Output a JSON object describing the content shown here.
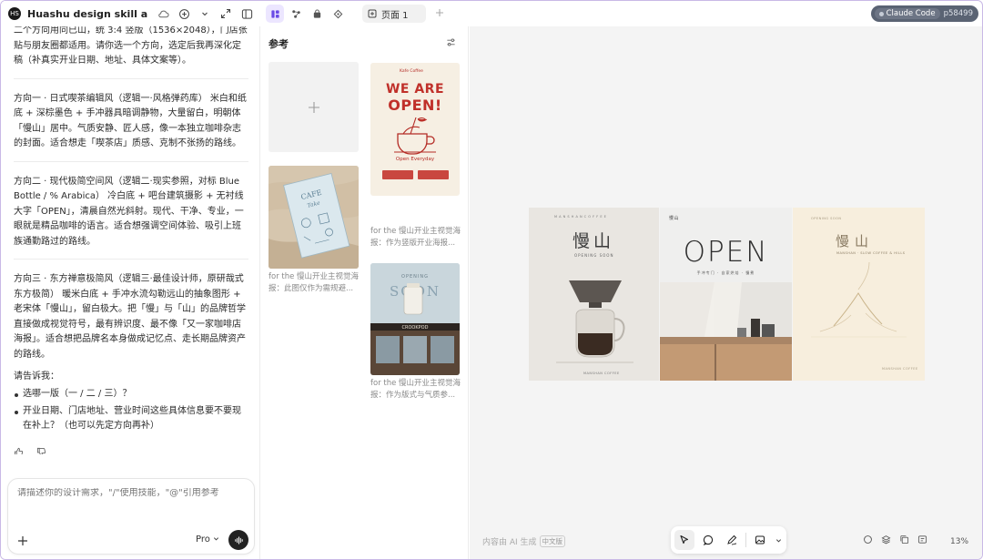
{
  "chat": {
    "logo_text": "HS",
    "title": "Huashu design skill activati...",
    "paragraphs": [
      "二个方向用同已山，统 3:4 竖版（1536×2048），门店张贴与朋友圈都适用。请你选一个方向，选定后我再深化定稿（补真实开业日期、地址、具体文案等）。",
      "方向一 · 日式喫茶编辑风（逻辑一·风格弹药库） 米白和纸底 + 深棕墨色 + 手冲器具暗调静物，大量留白，明朝体「慢山」居中。气质安静、匠人感，像一本独立咖啡杂志的封面。适合想走「喫茶店」质感、克制不张扬的路线。",
      "方向二 · 现代极简空间风（逻辑二·现实参照，对标 Blue Bottle / % Arabica） 冷白底 + 吧台建筑摄影 + 无衬线大字「OPEN」，清晨自然光斜射。现代、干净、专业，一眼就是精品咖啡的语言。适合想强调空间体验、吸引上班族通勤路过的路线。",
      "方向三 · 东方禅意极简风（逻辑三·最佳设计师，原研哉式东方极简） 暖米白底 + 手冲水流勾勒远山的抽象图形 + 老宋体「慢山」，留白极大。把「慢」与「山」的品牌哲学直接做成视觉符号，最有辨识度、最不像「又一家咖啡店海报」。适合想把品牌名本身做成记忆点、走长期品牌资产的路线。"
    ],
    "ask": "请告诉我：",
    "bullets": [
      "选哪一版（一 / 二 / 三）？",
      "开业日期、门店地址、营业时间这些具体信息要不要现在补上？（也可以先定方向再补）"
    ],
    "composer_placeholder": "请描述你的设计需求，\"/\"使用技能，\"@\"引用参考",
    "model_label": "Pro"
  },
  "toolbar": {
    "page_tab": "页面 1",
    "claude_label": "Claude Code",
    "session_id": "p58499"
  },
  "refs": {
    "title": "参考",
    "wao": {
      "brand": "Kafe Coffee",
      "line1": "WE ARE",
      "line2": "OPEN!",
      "open_label": "Open Everyday"
    },
    "captions": [
      "for the 慢山开业主视觉海报：此图仅作为需规避...",
      "for the 慢山开业主视觉海报：作为竖版开业海报...",
      "for the 慢山开业主视觉海报：作为版式与气质参..."
    ]
  },
  "canvas": {
    "p1": {
      "title": "慢山",
      "sub": "OPENING SOON",
      "small": "M A N S H A N   C O F F E E"
    },
    "p2": {
      "title": "OPEN",
      "sub": "手冲专门 · 自家烘焙 · 慢煮",
      "small": "慢山"
    },
    "p3": {
      "title": "慢山",
      "sub": "MANSHAN · SLOW COFFEE & HILLS",
      "small": "MANSHAN COFFEE"
    },
    "ai_note": "内容由 AI 生成",
    "ai_tag": "中文版",
    "zoom": "13%"
  }
}
